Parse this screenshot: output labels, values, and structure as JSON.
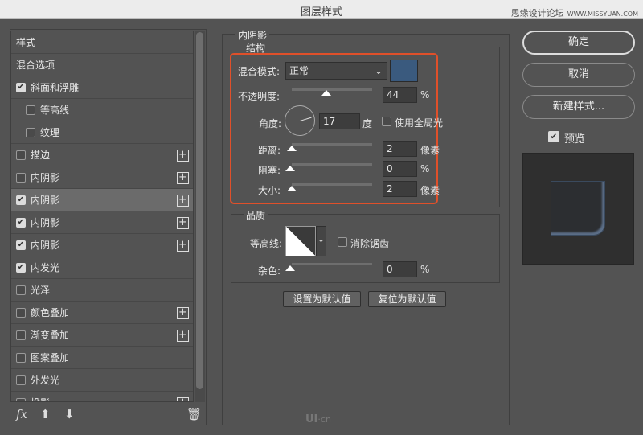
{
  "window": {
    "title": "图层样式",
    "watermark": "思缘设计论坛",
    "watermark_url": "WWW.MISSYUAN.COM"
  },
  "sidebar": {
    "items": [
      {
        "label": "样式",
        "checkbox": false,
        "checked": false,
        "plus": false,
        "indent": false
      },
      {
        "label": "混合选项",
        "checkbox": false,
        "checked": false,
        "plus": false,
        "indent": false
      },
      {
        "label": "斜面和浮雕",
        "checkbox": true,
        "checked": true,
        "plus": false,
        "indent": false
      },
      {
        "label": "等高线",
        "checkbox": true,
        "checked": false,
        "plus": false,
        "indent": true
      },
      {
        "label": "纹理",
        "checkbox": true,
        "checked": false,
        "plus": false,
        "indent": true
      },
      {
        "label": "描边",
        "checkbox": true,
        "checked": false,
        "plus": true,
        "indent": false
      },
      {
        "label": "内阴影",
        "checkbox": true,
        "checked": false,
        "plus": true,
        "indent": false
      },
      {
        "label": "内阴影",
        "checkbox": true,
        "checked": true,
        "plus": true,
        "indent": false,
        "selected": true
      },
      {
        "label": "内阴影",
        "checkbox": true,
        "checked": true,
        "plus": true,
        "indent": false
      },
      {
        "label": "内阴影",
        "checkbox": true,
        "checked": true,
        "plus": true,
        "indent": false
      },
      {
        "label": "内发光",
        "checkbox": true,
        "checked": true,
        "plus": false,
        "indent": false
      },
      {
        "label": "光泽",
        "checkbox": true,
        "checked": false,
        "plus": false,
        "indent": false
      },
      {
        "label": "颜色叠加",
        "checkbox": true,
        "checked": false,
        "plus": true,
        "indent": false
      },
      {
        "label": "渐变叠加",
        "checkbox": true,
        "checked": false,
        "plus": true,
        "indent": false
      },
      {
        "label": "图案叠加",
        "checkbox": true,
        "checked": false,
        "plus": false,
        "indent": false
      },
      {
        "label": "外发光",
        "checkbox": true,
        "checked": false,
        "plus": false,
        "indent": false
      },
      {
        "label": "投影",
        "checkbox": true,
        "checked": false,
        "plus": true,
        "indent": false
      }
    ],
    "toolbar": {
      "fx": "fx"
    }
  },
  "panel": {
    "title": "内阴影",
    "structure": {
      "title": "结构",
      "blend_mode_label": "混合模式:",
      "blend_mode": "正常",
      "color": "#3a5a7e",
      "opacity_label": "不透明度:",
      "opacity": "44",
      "opacity_unit": "%",
      "angle_label": "角度:",
      "angle": "17",
      "angle_unit": "度",
      "global_light_label": "使用全局光",
      "global_light": false,
      "distance_label": "距离:",
      "distance": "2",
      "distance_unit": "像素",
      "choke_label": "阻塞:",
      "choke": "0",
      "choke_unit": "%",
      "size_label": "大小:",
      "size": "2",
      "size_unit": "像素"
    },
    "quality": {
      "title": "品质",
      "contour_label": "等高线:",
      "antialias_label": "消除锯齿",
      "antialias": false,
      "noise_label": "杂色:",
      "noise": "0",
      "noise_unit": "%"
    },
    "make_default": "设置为默认值",
    "reset_default": "复位为默认值"
  },
  "actions": {
    "ok": "确定",
    "cancel": "取消",
    "new_style": "新建样式...",
    "preview_label": "预览",
    "preview": true
  },
  "highlight_color": "#e0502a",
  "logo_text": "UI·cn"
}
